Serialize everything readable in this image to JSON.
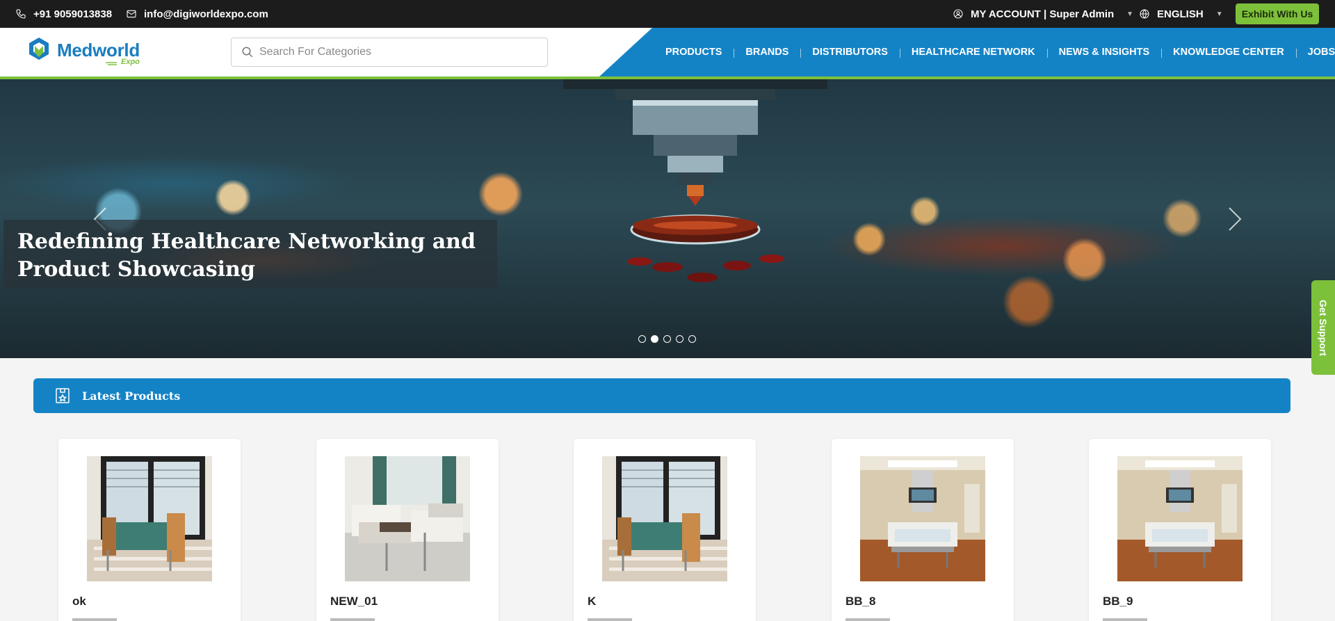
{
  "topbar": {
    "phone": "+91 9059013838",
    "email": "info@digiworldexpo.com",
    "account": "MY ACCOUNT | Super Admin",
    "language": "ENGLISH",
    "exhibit_button": "Exhibit With Us"
  },
  "header": {
    "logo_name": "Medworld",
    "logo_sub": "Expo",
    "search_placeholder": "Search For Categories",
    "nav": [
      "PRODUCTS",
      "BRANDS",
      "DISTRIBUTORS",
      "HEALTHCARE NETWORK",
      "NEWS & INSIGHTS",
      "KNOWLEDGE CENTER",
      "JOBS"
    ]
  },
  "hero": {
    "caption_line1": "Redefining Healthcare Networking and",
    "caption_line2": "Product Showcasing",
    "slide_count": 5,
    "active_slide": 2
  },
  "support_tab": "Get Support",
  "latest": {
    "title": "Latest Products",
    "products": [
      "ok",
      "NEW_01",
      "K",
      "BB_8",
      "BB_9"
    ]
  },
  "colors": {
    "brand_blue": "#1483c6",
    "brand_green": "#7dc13b",
    "topbar_bg": "#1c1c1c"
  }
}
